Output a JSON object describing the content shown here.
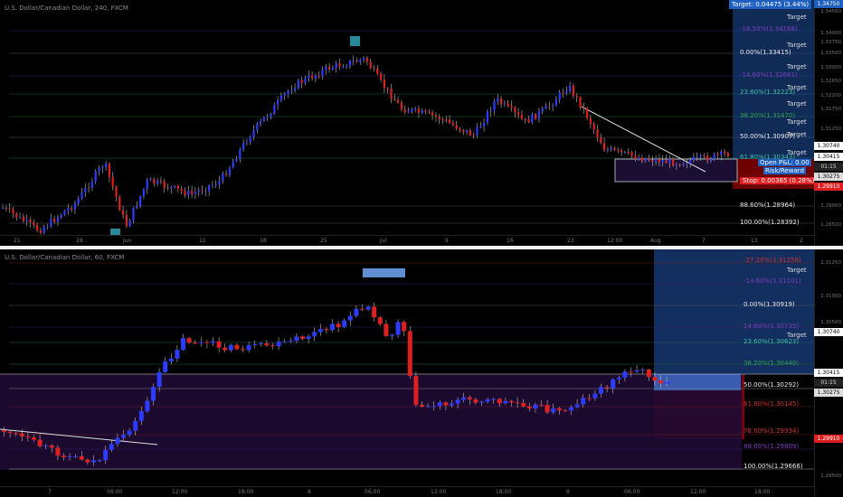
{
  "top": {
    "title": "U.S. Dollar/Canadian Dollar, 240, FXCM",
    "time_labels": [
      "21",
      "28",
      "Jun",
      "11",
      "18",
      "25",
      "Jul",
      "9",
      "16",
      "23",
      "12:00",
      "Aug",
      "7",
      "13",
      "2"
    ],
    "price_labels": [
      "1.34750",
      "1.34500",
      "1.34000",
      "1.33750",
      "1.33500",
      "1.33000",
      "1.32650",
      "1.32200",
      "1.31750",
      "1.31250",
      "1.30740",
      "1.30415",
      "1.30275",
      "1.29910",
      "1.29000",
      "1.28500"
    ],
    "current_time": "01:15",
    "target_box": "Target: 0.04475 (3.44%)",
    "target_word": "Target",
    "open_pl": "Open P&L: 0.00",
    "risk_reward": "Risk/Reward",
    "stop_box": "Stop: 0.00365 (0.28%)",
    "fib_levels": [
      {
        "text": "-16.50%(1.34168)",
        "color": "#7b3fbf"
      },
      {
        "text": "0.00%(1.33415)",
        "color": "#e8e8e8"
      },
      {
        "text": "-14.60%(1.32661)",
        "color": "#7b3fbf"
      },
      {
        "text": "23.60%(1.32223)",
        "color": "#3fbfa6"
      },
      {
        "text": "38.20%(1.31470)",
        "color": "#2fa54f"
      },
      {
        "text": "50.00%(1.30907)",
        "color": "#e8e8e8"
      },
      {
        "text": "61.80%(1.30343)",
        "color": "#3fbfa6"
      },
      {
        "text": "88.60%(1.28964)",
        "color": "#e8e8e8"
      },
      {
        "text": "100.00%(1.28392)",
        "color": "#e8e8e8"
      }
    ]
  },
  "bottom": {
    "title": "U.S. Dollar/Canadian Dollar, 60, FXCM",
    "time_labels": [
      "7",
      "06:00",
      "12:00",
      "18:00",
      "8",
      "06:00",
      "12:00",
      "18:00",
      "9",
      "06:00",
      "12:00",
      "18:00"
    ],
    "price_labels": [
      "1.31250",
      "1.31000",
      "1.30500",
      "1.30740",
      "1.30415",
      "1.30275",
      "1.29910",
      "1.29500"
    ],
    "current_time": "01:15",
    "target_word": "Target",
    "fib_levels": [
      {
        "text": "-27.20%(1.31258)",
        "color": "#cc3333"
      },
      {
        "text": "-14.60%(1.31101)",
        "color": "#7b3fbf"
      },
      {
        "text": "0.00%(1.30919)",
        "color": "#e8e8e8"
      },
      {
        "text": "14.60%(1.30735)",
        "color": "#7b3fbf"
      },
      {
        "text": "23.60%(1.30623)",
        "color": "#3fbfa6"
      },
      {
        "text": "38.20%(1.30440)",
        "color": "#2fa54f"
      },
      {
        "text": "50.00%(1.30292)",
        "color": "#e8e8e8"
      },
      {
        "text": "61.80%(1.30145)",
        "color": "#cc3333"
      },
      {
        "text": "78.60%(1.29934)",
        "color": "#cc3333"
      },
      {
        "text": "88.60%(1.29809)",
        "color": "#7b3fbf"
      },
      {
        "text": "100.00%(1.29666)",
        "color": "#e8e8e8"
      }
    ]
  },
  "colors": {
    "up": "#2b3bff",
    "down": "#e02020",
    "target_blue": "#1f4f9e",
    "stop_red": "#8b0000"
  }
}
